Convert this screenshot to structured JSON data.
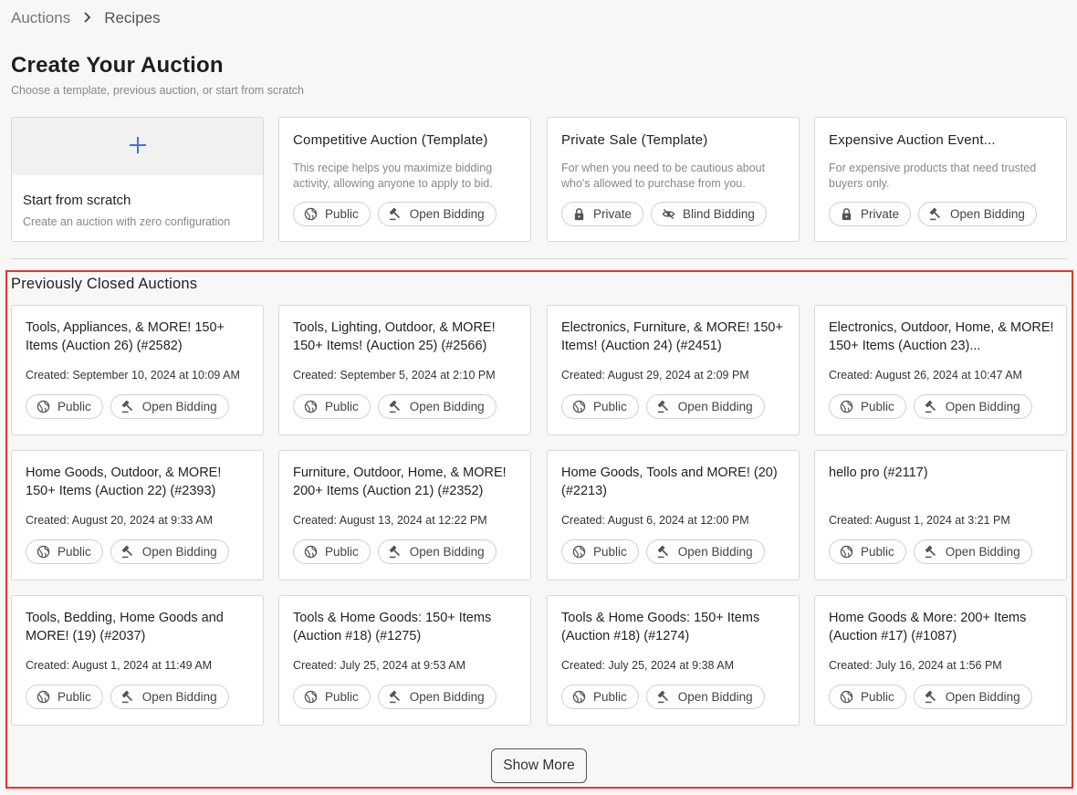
{
  "breadcrumb": {
    "root": "Auctions",
    "current": "Recipes"
  },
  "page": {
    "title": "Create Your Auction",
    "subtitle": "Choose a template, previous auction, or start from scratch"
  },
  "scratch": {
    "title": "Start from scratch",
    "description": "Create an auction with zero configuration",
    "icon": "plus-icon"
  },
  "templates": [
    {
      "title": "Competitive Auction (Template)",
      "description": "This recipe helps you maximize bidding activity, allowing anyone to apply to bid.",
      "visibility": "Public",
      "bidding": "Open Bidding"
    },
    {
      "title": "Private Sale (Template)",
      "description": "For when you need to be cautious about who's allowed to purchase from you.",
      "visibility": "Private",
      "bidding": "Blind Bidding"
    },
    {
      "title": "Expensive Auction Event...",
      "description": "For expensive products that need trusted buyers only.",
      "visibility": "Private",
      "bidding": "Open Bidding"
    }
  ],
  "closed": {
    "section_title": "Previously Closed Auctions",
    "show_more_label": "Show More",
    "auctions": [
      {
        "title": "Tools, Appliances, & MORE! 150+ Items (Auction 26) (#2582)",
        "created": "Created: September 10, 2024 at 10:09 AM",
        "visibility": "Public",
        "bidding": "Open Bidding"
      },
      {
        "title": "Tools, Lighting, Outdoor, & MORE! 150+ Items! (Auction 25) (#2566)",
        "created": "Created: September 5, 2024 at 2:10 PM",
        "visibility": "Public",
        "bidding": "Open Bidding"
      },
      {
        "title": "Electronics, Furniture, & MORE! 150+ Items! (Auction 24) (#2451)",
        "created": "Created: August 29, 2024 at 2:09 PM",
        "visibility": "Public",
        "bidding": "Open Bidding"
      },
      {
        "title": "Electronics, Outdoor, Home, & MORE! 150+ Items (Auction 23)...",
        "created": "Created: August 26, 2024 at 10:47 AM",
        "visibility": "Public",
        "bidding": "Open Bidding"
      },
      {
        "title": "Home Goods, Outdoor, & MORE! 150+ Items (Auction 22) (#2393)",
        "created": "Created: August 20, 2024 at 9:33 AM",
        "visibility": "Public",
        "bidding": "Open Bidding"
      },
      {
        "title": "Furniture, Outdoor, Home, & MORE! 200+ Items (Auction 21) (#2352)",
        "created": "Created: August 13, 2024 at 12:22 PM",
        "visibility": "Public",
        "bidding": "Open Bidding"
      },
      {
        "title": "Home Goods, Tools and MORE! (20) (#2213)",
        "created": "Created: August 6, 2024 at 12:00 PM",
        "visibility": "Public",
        "bidding": "Open Bidding"
      },
      {
        "title": "hello pro (#2117)",
        "created": "Created: August 1, 2024 at 3:21 PM",
        "visibility": "Public",
        "bidding": "Open Bidding"
      },
      {
        "title": "Tools, Bedding, Home Goods and MORE! (19) (#2037)",
        "created": "Created: August 1, 2024 at 11:49 AM",
        "visibility": "Public",
        "bidding": "Open Bidding"
      },
      {
        "title": "Tools & Home Goods: 150+ Items (Auction #18) (#1275)",
        "created": "Created: July 25, 2024 at 9:53 AM",
        "visibility": "Public",
        "bidding": "Open Bidding"
      },
      {
        "title": "Tools & Home Goods: 150+ Items (Auction #18) (#1274)",
        "created": "Created: July 25, 2024 at 9:38 AM",
        "visibility": "Public",
        "bidding": "Open Bidding"
      },
      {
        "title": "Home Goods & More: 200+ Items (Auction #17) (#1087)",
        "created": "Created: July 16, 2024 at 1:56 PM",
        "visibility": "Public",
        "bidding": "Open Bidding"
      }
    ]
  },
  "colors": {
    "accent": "#4a6fd6",
    "highlight": "#e8352a"
  }
}
